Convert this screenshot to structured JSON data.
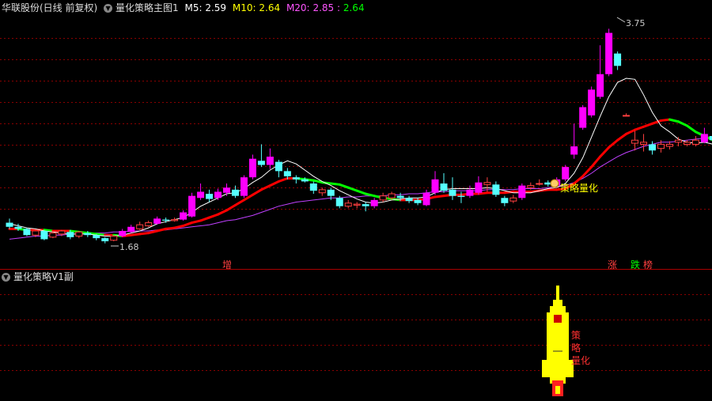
{
  "header": {
    "stock_name": "华联股份(日线 前复权)",
    "indicator_name": "量化策略主图1",
    "ma5_label": "M5:",
    "ma5_value": "2.59",
    "ma10_label": "M10:",
    "ma10_value": "2.64",
    "ma20_label": "M20:",
    "ma20_value": "2.85",
    "ma20_sep": ":",
    "ma20_value2": "2.64"
  },
  "sub_panel": {
    "title": "量化策略V1副"
  },
  "annotations": {
    "high_label": "3.75",
    "low_label": "1.68",
    "strategy_label": "策略量化",
    "marker_zeng": "增",
    "marker_zhang": "涨",
    "marker_die": "跌",
    "marker_bang": "榜",
    "sub_label_1": "策",
    "sub_label_2": "略",
    "sub_label_3": "量化"
  },
  "colors": {
    "up": "#ff00ff",
    "down": "#55ffff",
    "up_small": "#ff4040",
    "ma5": "#ffffff",
    "ma10_up": "#ff0000",
    "ma10_down": "#00ff00",
    "ma20": "#c040ff",
    "header_ma5": "#ffffff",
    "header_ma10": "#ffff00",
    "header_ma20": "#ff55ff",
    "header_ma20b": "#00ff00"
  },
  "chart_data": {
    "type": "candlestick",
    "ylim": [
      1.55,
      3.85
    ],
    "high": 3.75,
    "low": 1.68,
    "candles": [
      [
        1.86,
        1.82,
        1.9,
        1.8
      ],
      [
        1.82,
        1.8,
        1.85,
        1.78
      ],
      [
        1.8,
        1.74,
        1.81,
        1.73
      ],
      [
        1.74,
        1.78,
        1.79,
        1.72
      ],
      [
        1.78,
        1.7,
        1.79,
        1.69
      ],
      [
        1.72,
        1.76,
        1.78,
        1.71
      ],
      [
        1.75,
        1.78,
        1.79,
        1.73
      ],
      [
        1.77,
        1.72,
        1.79,
        1.7
      ],
      [
        1.73,
        1.77,
        1.78,
        1.71
      ],
      [
        1.76,
        1.74,
        1.78,
        1.72
      ],
      [
        1.74,
        1.71,
        1.75,
        1.69
      ],
      [
        1.71,
        1.68,
        1.72,
        1.66
      ],
      [
        1.69,
        1.73,
        1.74,
        1.68
      ],
      [
        1.73,
        1.78,
        1.8,
        1.72
      ],
      [
        1.77,
        1.82,
        1.84,
        1.76
      ],
      [
        1.8,
        1.84,
        1.87,
        1.79
      ],
      [
        1.83,
        1.86,
        1.88,
        1.82
      ],
      [
        1.85,
        1.9,
        1.92,
        1.84
      ],
      [
        1.89,
        1.88,
        1.91,
        1.86
      ],
      [
        1.88,
        1.89,
        1.91,
        1.87
      ],
      [
        1.89,
        1.96,
        1.98,
        1.88
      ],
      [
        1.92,
        2.12,
        2.15,
        1.91
      ],
      [
        2.1,
        2.16,
        2.24,
        2.08
      ],
      [
        2.14,
        2.09,
        2.18,
        2.06
      ],
      [
        2.1,
        2.16,
        2.19,
        2.08
      ],
      [
        2.15,
        2.2,
        2.24,
        2.12
      ],
      [
        2.18,
        2.12,
        2.22,
        2.1
      ],
      [
        2.12,
        2.3,
        2.32,
        2.1
      ],
      [
        2.3,
        2.48,
        2.52,
        2.28
      ],
      [
        2.46,
        2.42,
        2.62,
        2.4
      ],
      [
        2.42,
        2.5,
        2.58,
        2.38
      ],
      [
        2.45,
        2.36,
        2.47,
        2.3
      ],
      [
        2.36,
        2.31,
        2.39,
        2.28
      ],
      [
        2.3,
        2.28,
        2.32,
        2.24
      ],
      [
        2.28,
        2.26,
        2.3,
        2.25
      ],
      [
        2.24,
        2.17,
        2.26,
        2.14
      ],
      [
        2.15,
        2.18,
        2.2,
        2.12
      ],
      [
        2.18,
        2.12,
        2.2,
        2.08
      ],
      [
        2.1,
        2.02,
        2.12,
        2.0
      ],
      [
        2.02,
        2.05,
        2.08,
        2.0
      ],
      [
        2.03,
        2.04,
        2.06,
        2.0
      ],
      [
        2.04,
        2.02,
        2.06,
        1.97
      ],
      [
        2.02,
        2.08,
        2.1,
        2.0
      ],
      [
        2.08,
        2.12,
        2.15,
        2.06
      ],
      [
        2.1,
        2.14,
        2.16,
        2.08
      ],
      [
        2.12,
        2.1,
        2.15,
        2.07
      ],
      [
        2.1,
        2.07,
        2.12,
        2.05
      ],
      [
        2.08,
        2.05,
        2.1,
        2.03
      ],
      [
        2.03,
        2.15,
        2.18,
        2.02
      ],
      [
        2.15,
        2.28,
        2.36,
        2.13
      ],
      [
        2.24,
        2.17,
        2.34,
        2.15
      ],
      [
        2.18,
        2.12,
        2.3,
        2.08
      ],
      [
        2.12,
        2.11,
        2.16,
        2.05
      ],
      [
        2.12,
        2.18,
        2.22,
        2.1
      ],
      [
        2.15,
        2.25,
        2.31,
        2.13
      ],
      [
        2.23,
        2.25,
        2.3,
        2.16
      ],
      [
        2.23,
        2.13,
        2.26,
        2.11
      ],
      [
        2.1,
        2.05,
        2.12,
        2.02
      ],
      [
        2.07,
        2.1,
        2.13,
        2.05
      ],
      [
        2.1,
        2.22,
        2.24,
        2.08
      ],
      [
        2.2,
        2.22,
        2.25,
        2.18
      ],
      [
        2.24,
        2.24,
        2.28,
        2.22
      ],
      [
        2.25,
        2.23,
        2.27,
        2.21
      ],
      [
        2.22,
        2.28,
        2.3,
        2.2
      ],
      [
        2.28,
        2.4,
        2.42,
        2.26
      ],
      [
        2.52,
        2.6,
        2.82,
        2.48
      ],
      [
        2.78,
        2.98,
        3.0,
        2.76
      ],
      [
        2.9,
        3.15,
        3.18,
        2.88
      ],
      [
        3.08,
        3.3,
        3.58,
        3.06
      ],
      [
        3.3,
        3.7,
        3.74,
        3.28
      ],
      [
        3.5,
        3.38,
        3.52,
        3.34
      ],
      [
        2.9,
        2.9,
        2.92,
        2.9
      ],
      [
        2.63,
        2.66,
        2.75,
        2.56
      ],
      [
        2.62,
        2.64,
        2.72,
        2.55
      ],
      [
        2.62,
        2.56,
        2.65,
        2.52
      ],
      [
        2.58,
        2.62,
        2.66,
        2.54
      ],
      [
        2.6,
        2.62,
        2.65,
        2.57
      ],
      [
        2.64,
        2.66,
        2.69,
        2.6
      ],
      [
        2.62,
        2.64,
        2.66,
        2.6
      ],
      [
        2.62,
        2.66,
        2.7,
        2.6
      ],
      [
        2.64,
        2.72,
        2.78,
        2.63
      ],
      [
        2.7,
        2.66,
        2.74,
        2.64
      ]
    ],
    "ma5": [
      1.85,
      1.83,
      1.81,
      1.8,
      1.78,
      1.77,
      1.76,
      1.75,
      1.75,
      1.75,
      1.74,
      1.73,
      1.73,
      1.74,
      1.76,
      1.78,
      1.81,
      1.85,
      1.87,
      1.89,
      1.91,
      1.96,
      2.02,
      2.06,
      2.1,
      2.14,
      2.15,
      2.19,
      2.25,
      2.3,
      2.37,
      2.42,
      2.46,
      2.43,
      2.37,
      2.31,
      2.26,
      2.22,
      2.17,
      2.13,
      2.09,
      2.06,
      2.05,
      2.06,
      2.08,
      2.09,
      2.1,
      2.1,
      2.11,
      2.15,
      2.18,
      2.19,
      2.19,
      2.19,
      2.19,
      2.2,
      2.19,
      2.17,
      2.15,
      2.15,
      2.15,
      2.17,
      2.19,
      2.2,
      2.24,
      2.34,
      2.49,
      2.69,
      2.89,
      3.08,
      3.22,
      3.26,
      3.25,
      3.1,
      2.93,
      2.8,
      2.74,
      2.67,
      2.64,
      2.63,
      2.64,
      2.62
    ],
    "ma10": [
      1.8,
      1.8,
      1.79,
      1.79,
      1.79,
      1.78,
      1.78,
      1.78,
      1.77,
      1.76,
      1.75,
      1.74,
      1.74,
      1.73,
      1.74,
      1.75,
      1.76,
      1.78,
      1.8,
      1.81,
      1.83,
      1.86,
      1.88,
      1.91,
      1.94,
      1.98,
      2.03,
      2.08,
      2.13,
      2.18,
      2.22,
      2.26,
      2.29,
      2.29,
      2.28,
      2.27,
      2.25,
      2.24,
      2.23,
      2.2,
      2.17,
      2.14,
      2.12,
      2.1,
      2.09,
      2.08,
      2.08,
      2.08,
      2.09,
      2.11,
      2.12,
      2.13,
      2.13,
      2.14,
      2.14,
      2.15,
      2.15,
      2.15,
      2.16,
      2.16,
      2.16,
      2.17,
      2.18,
      2.18,
      2.19,
      2.24,
      2.31,
      2.4,
      2.5,
      2.59,
      2.66,
      2.72,
      2.76,
      2.79,
      2.82,
      2.85,
      2.86,
      2.84,
      2.8,
      2.74,
      2.7,
      2.66
    ],
    "ma20": [
      1.7,
      1.71,
      1.72,
      1.73,
      1.73,
      1.74,
      1.74,
      1.75,
      1.75,
      1.75,
      1.76,
      1.76,
      1.77,
      1.77,
      1.78,
      1.78,
      1.78,
      1.79,
      1.79,
      1.8,
      1.81,
      1.82,
      1.83,
      1.84,
      1.86,
      1.88,
      1.89,
      1.91,
      1.93,
      1.96,
      1.99,
      2.02,
      2.04,
      2.06,
      2.07,
      2.08,
      2.09,
      2.1,
      2.1,
      2.11,
      2.11,
      2.12,
      2.12,
      2.12,
      2.13,
      2.13,
      2.14,
      2.14,
      2.15,
      2.16,
      2.16,
      2.17,
      2.17,
      2.17,
      2.17,
      2.18,
      2.18,
      2.18,
      2.18,
      2.19,
      2.19,
      2.19,
      2.2,
      2.21,
      2.22,
      2.25,
      2.29,
      2.34,
      2.4,
      2.45,
      2.5,
      2.54,
      2.57,
      2.6,
      2.62,
      2.64,
      2.64,
      2.65,
      2.66,
      2.67,
      2.68,
      2.7
    ]
  }
}
